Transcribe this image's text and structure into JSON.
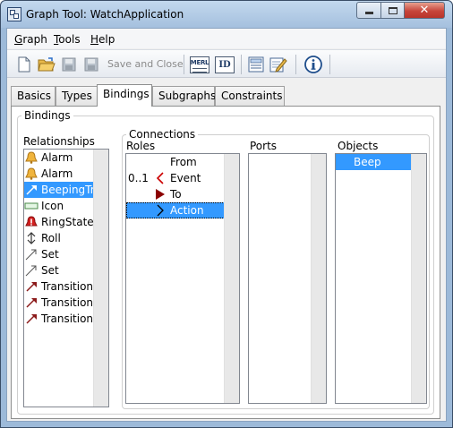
{
  "window": {
    "title": "Graph Tool: WatchApplication",
    "controls": {
      "minimize_icon": "minimize-icon",
      "maximize_icon": "maximize-icon",
      "close_glyph": "✕"
    }
  },
  "menu": [
    {
      "label_underlined": "G",
      "label_rest": "raph"
    },
    {
      "label_underlined": "T",
      "label_rest": "ools"
    },
    {
      "label_underlined": "H",
      "label_rest": "elp"
    }
  ],
  "toolbar": {
    "save_and_close_label": "Save and Close",
    "merl_label": "MERL",
    "id_label": "ID",
    "icons": [
      "new-document-icon",
      "open-folder-icon",
      "save-icon",
      "save-all-icon",
      "save-and-close",
      "merl-generator-icon",
      "id-icon",
      "properties-icon",
      "edit-icon",
      "info-icon"
    ]
  },
  "tabs": [
    {
      "label": "Basics",
      "active": false
    },
    {
      "label": "Types",
      "active": false
    },
    {
      "label": "Bindings",
      "active": true
    },
    {
      "label": "Subgraphs",
      "active": false
    },
    {
      "label": "Constraints",
      "active": false
    }
  ],
  "bindings": {
    "group_title": "Bindings",
    "relationships": {
      "label": "Relationships",
      "items": [
        {
          "label": "Alarm",
          "icon": "bell-icon"
        },
        {
          "label": "Alarm",
          "icon": "bell-icon"
        },
        {
          "label": "BeepingTran",
          "icon": "transition-arrow-icon",
          "selected": true
        },
        {
          "label": "Icon",
          "icon": "icon-rectangle-icon"
        },
        {
          "label": "RingState",
          "icon": "ringing-bell-icon"
        },
        {
          "label": "Roll",
          "icon": "roll-arrows-icon"
        },
        {
          "label": "Set",
          "icon": "set-arrow-icon"
        },
        {
          "label": "Set",
          "icon": "set-arrow-icon"
        },
        {
          "label": "Transition",
          "icon": "transition-arrow-icon"
        },
        {
          "label": "Transition",
          "icon": "transition-arrow-icon"
        },
        {
          "label": "Transition",
          "icon": "transition-arrow-icon"
        }
      ]
    },
    "connections": {
      "group_title": "Connections",
      "roles": {
        "label": "Roles",
        "items": [
          {
            "cardinality": "",
            "label": "From",
            "icon": ""
          },
          {
            "cardinality": "0..1",
            "label": "Event",
            "icon": "chevron-left-icon"
          },
          {
            "cardinality": "",
            "label": "To",
            "icon": "triangle-right-icon"
          },
          {
            "cardinality": "",
            "label": "Action",
            "icon": "chevron-right-icon",
            "selected": true
          }
        ]
      },
      "ports": {
        "label": "Ports",
        "items": []
      },
      "objects": {
        "label": "Objects",
        "items": [
          {
            "label": "Beep",
            "selected": true
          }
        ]
      }
    }
  },
  "colors": {
    "selection": "#3399ff",
    "title_bar": "#b4cce6",
    "close_button": "#c7453a",
    "relationship_arrow": "#8b1a1a",
    "role_marker": "#cc0000"
  }
}
